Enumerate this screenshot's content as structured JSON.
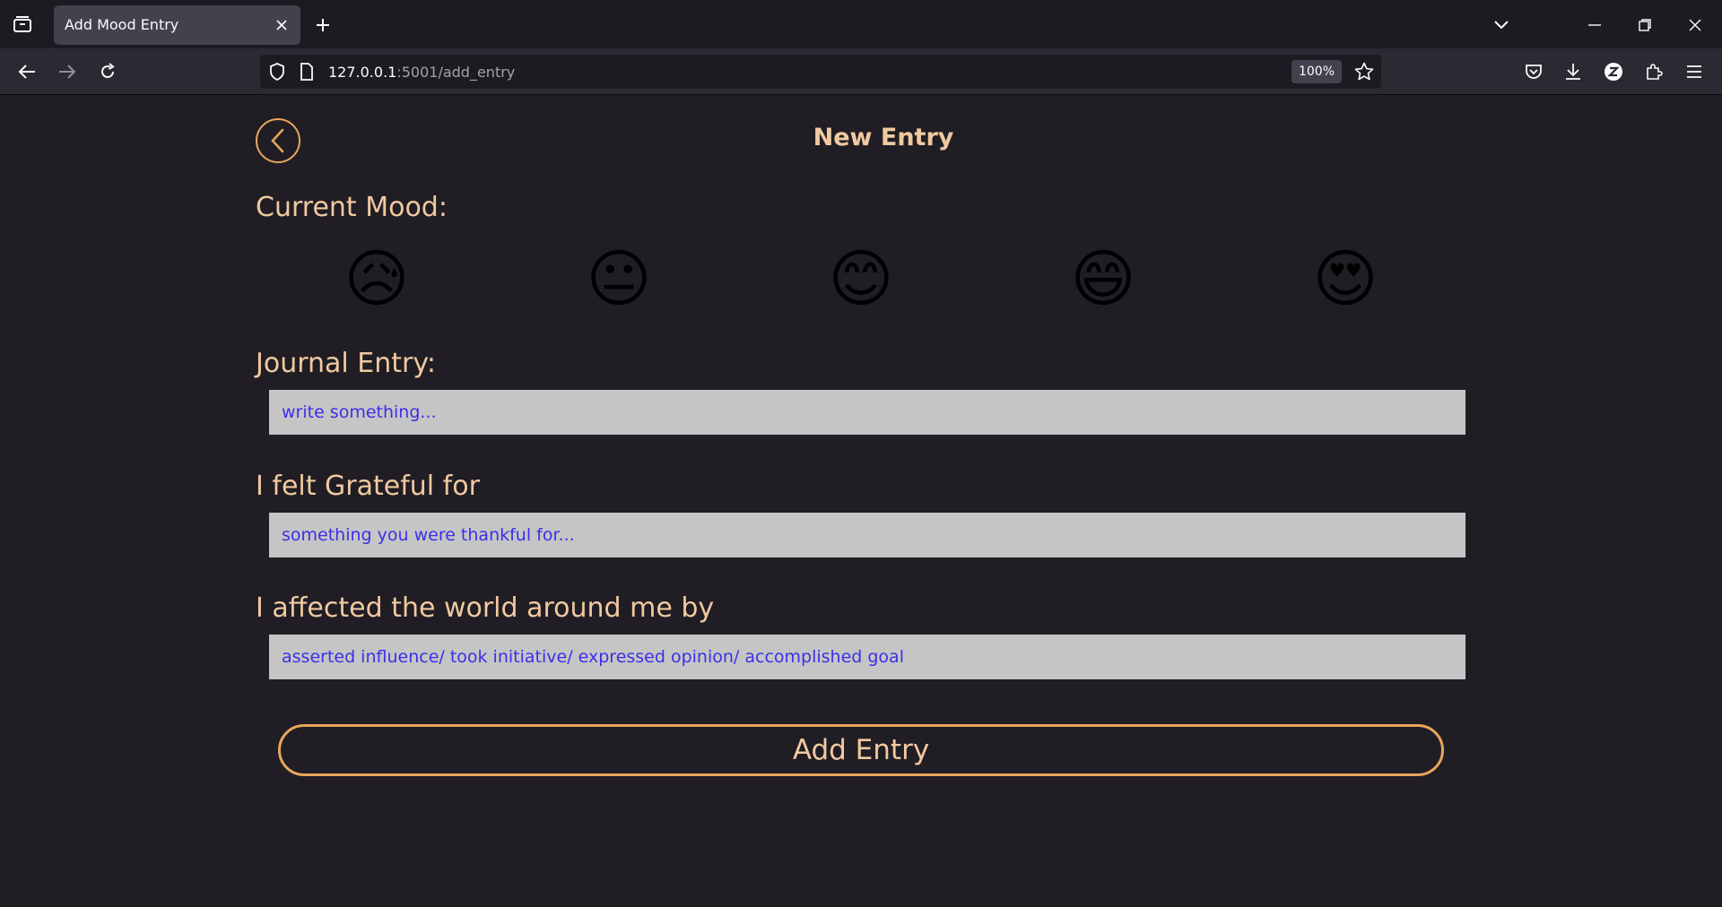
{
  "browser": {
    "tab_title": "Add Mood Entry",
    "url_host": "127.0.0.1",
    "url_path": ":5001/add_entry",
    "zoom": "100%"
  },
  "page": {
    "title": "New Entry",
    "mood_label": "Current Mood:",
    "moods": [
      {
        "emoji": "😥",
        "name": "sad"
      },
      {
        "emoji": "😐",
        "name": "neutral"
      },
      {
        "emoji": "😊",
        "name": "content"
      },
      {
        "emoji": "😄",
        "name": "happy"
      },
      {
        "emoji": "😍",
        "name": "loving"
      }
    ],
    "journal_label": "Journal Entry:",
    "journal_placeholder": "write something...",
    "grateful_label": "I felt Grateful for",
    "grateful_placeholder": "something you were thankful for...",
    "affected_label": "I affected the world around me by",
    "affected_placeholder": "asserted influence/ took initiative/ expressed opinion/ accomplished goal",
    "submit_label": "Add Entry"
  },
  "colors": {
    "background": "#201e24",
    "accent": "#e8a55c",
    "label_text": "#f0c9a0",
    "input_bg": "#c5c5c5",
    "input_text": "#3b30e8"
  }
}
